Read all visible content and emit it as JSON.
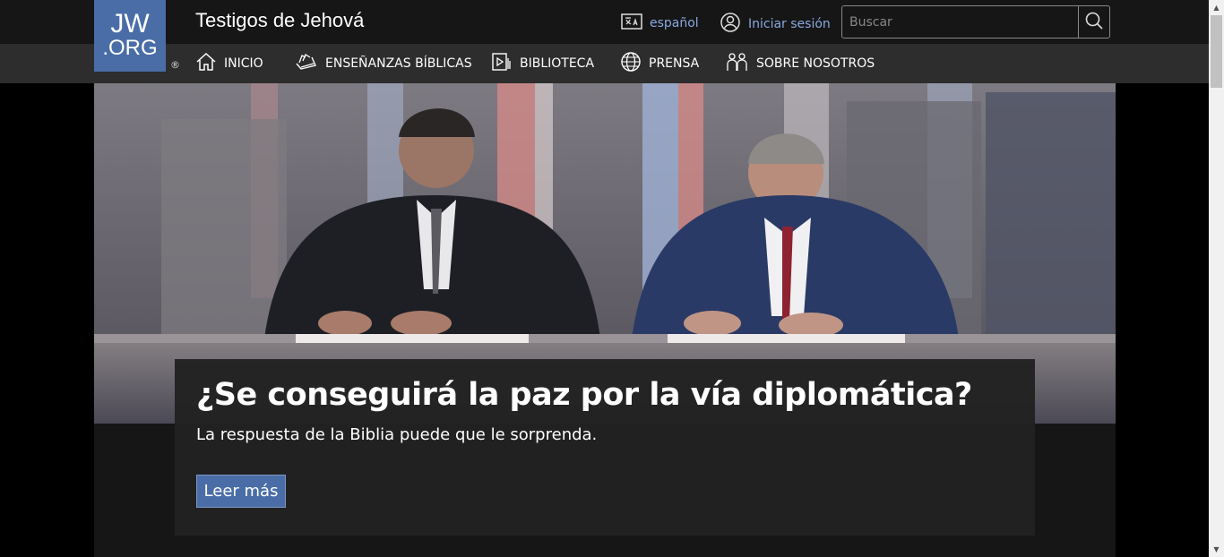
{
  "header": {
    "logo_line1": "JW",
    "logo_line2": ".ORG",
    "registered_mark": "®",
    "site_title": "Testigos de Jehová",
    "language_label": "español",
    "login_label": "Iniciar sesión",
    "search_placeholder": "Buscar"
  },
  "nav": {
    "items": [
      {
        "label": "INICIO",
        "icon": "home-icon"
      },
      {
        "label": "ENSEÑANZAS BÍBLICAS",
        "icon": "open-bible-icon"
      },
      {
        "label": "BIBLIOTECA",
        "icon": "library-media-icon"
      },
      {
        "label": "PRENSA",
        "icon": "globe-icon"
      },
      {
        "label": "SOBRE NOSOTROS",
        "icon": "people-icon"
      }
    ]
  },
  "hero": {
    "headline": "¿Se conseguirá la paz por la vía diplomática?",
    "subtitle": "La respuesta de la Biblia puede que le sorprenda.",
    "cta_label": "Leer más"
  },
  "colors": {
    "brand": "#4a6da7",
    "link": "#8aa8e0",
    "header_bg": "#161616",
    "nav_bg": "#2d2d2d"
  }
}
